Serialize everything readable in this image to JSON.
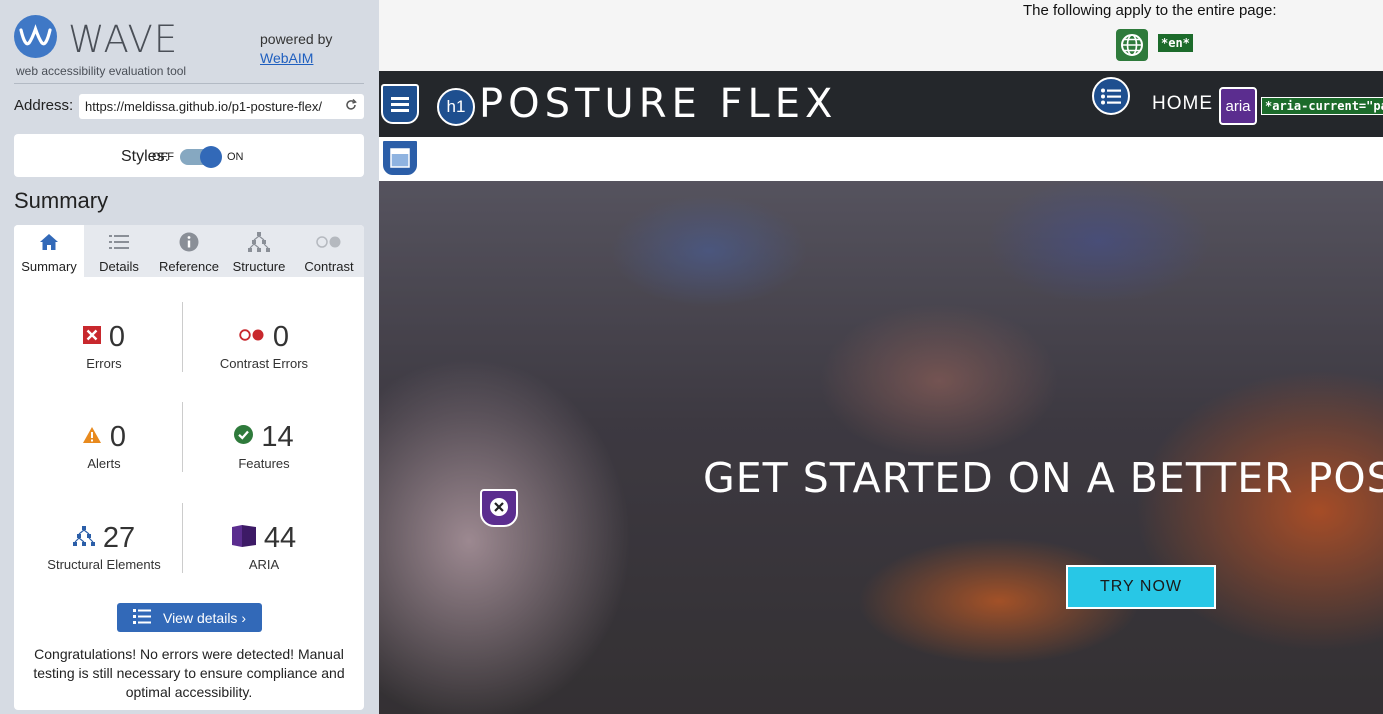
{
  "wave": {
    "logo_text": "WAVE",
    "tagline": "web accessibility evaluation tool",
    "powered_by": "powered by",
    "webaim_link": "WebAIM",
    "address_label": "Address:",
    "address_value": "https://meldissa.github.io/p1-posture-flex/",
    "styles_label": "Styles:",
    "styles_off": "OFF",
    "styles_on": "ON",
    "styles_state": "on",
    "summary_heading": "Summary",
    "tabs": [
      {
        "label": "Summary",
        "icon": "home-icon",
        "active": true
      },
      {
        "label": "Details",
        "icon": "list-icon",
        "active": false
      },
      {
        "label": "Reference",
        "icon": "info-icon",
        "active": false
      },
      {
        "label": "Structure",
        "icon": "structure-icon",
        "active": false
      },
      {
        "label": "Contrast",
        "icon": "contrast-icon",
        "active": false
      }
    ],
    "stats": {
      "errors": {
        "value": "0",
        "label": "Errors",
        "icon": "error-icon",
        "color": "#c8282d"
      },
      "contrast_errors": {
        "value": "0",
        "label": "Contrast Errors",
        "icon": "contrast-error-icon",
        "color": "#c8282d"
      },
      "alerts": {
        "value": "0",
        "label": "Alerts",
        "icon": "alert-icon",
        "color": "#e88a1e"
      },
      "features": {
        "value": "14",
        "label": "Features",
        "icon": "feature-check-icon",
        "color": "#2e7a3b"
      },
      "structural": {
        "value": "27",
        "label": "Structural Elements",
        "icon": "structure-tree-icon",
        "color": "#2b5ea8"
      },
      "aria": {
        "value": "44",
        "label": "ARIA",
        "icon": "aria-icon",
        "color": "#5b2d8f"
      }
    },
    "view_details_button": "View details ›",
    "congrats": "Congratulations! No errors were detected! Manual testing is still necessary to ensure compliance and optimal accessibility."
  },
  "page": {
    "applies_text": "The following apply to the entire page:",
    "lang_code": "*en*",
    "brand": "POSTURE FLEX",
    "h1_badge": "h1",
    "nav_home": "HOME",
    "aria_badge": "aria",
    "aria_current": "*aria-current=\"page\"*",
    "hero_title": "GET STARTED ON A BETTER POSTURE",
    "try_button": "TRY NOW"
  },
  "colors": {
    "sidebar_bg": "#d6dbe3",
    "wave_blue": "#3269b8",
    "navbar_bg": "#24272b",
    "aria_purple": "#5b2d8f",
    "feature_green": "#2e7a3b",
    "cta_cyan": "#28c7e6"
  }
}
